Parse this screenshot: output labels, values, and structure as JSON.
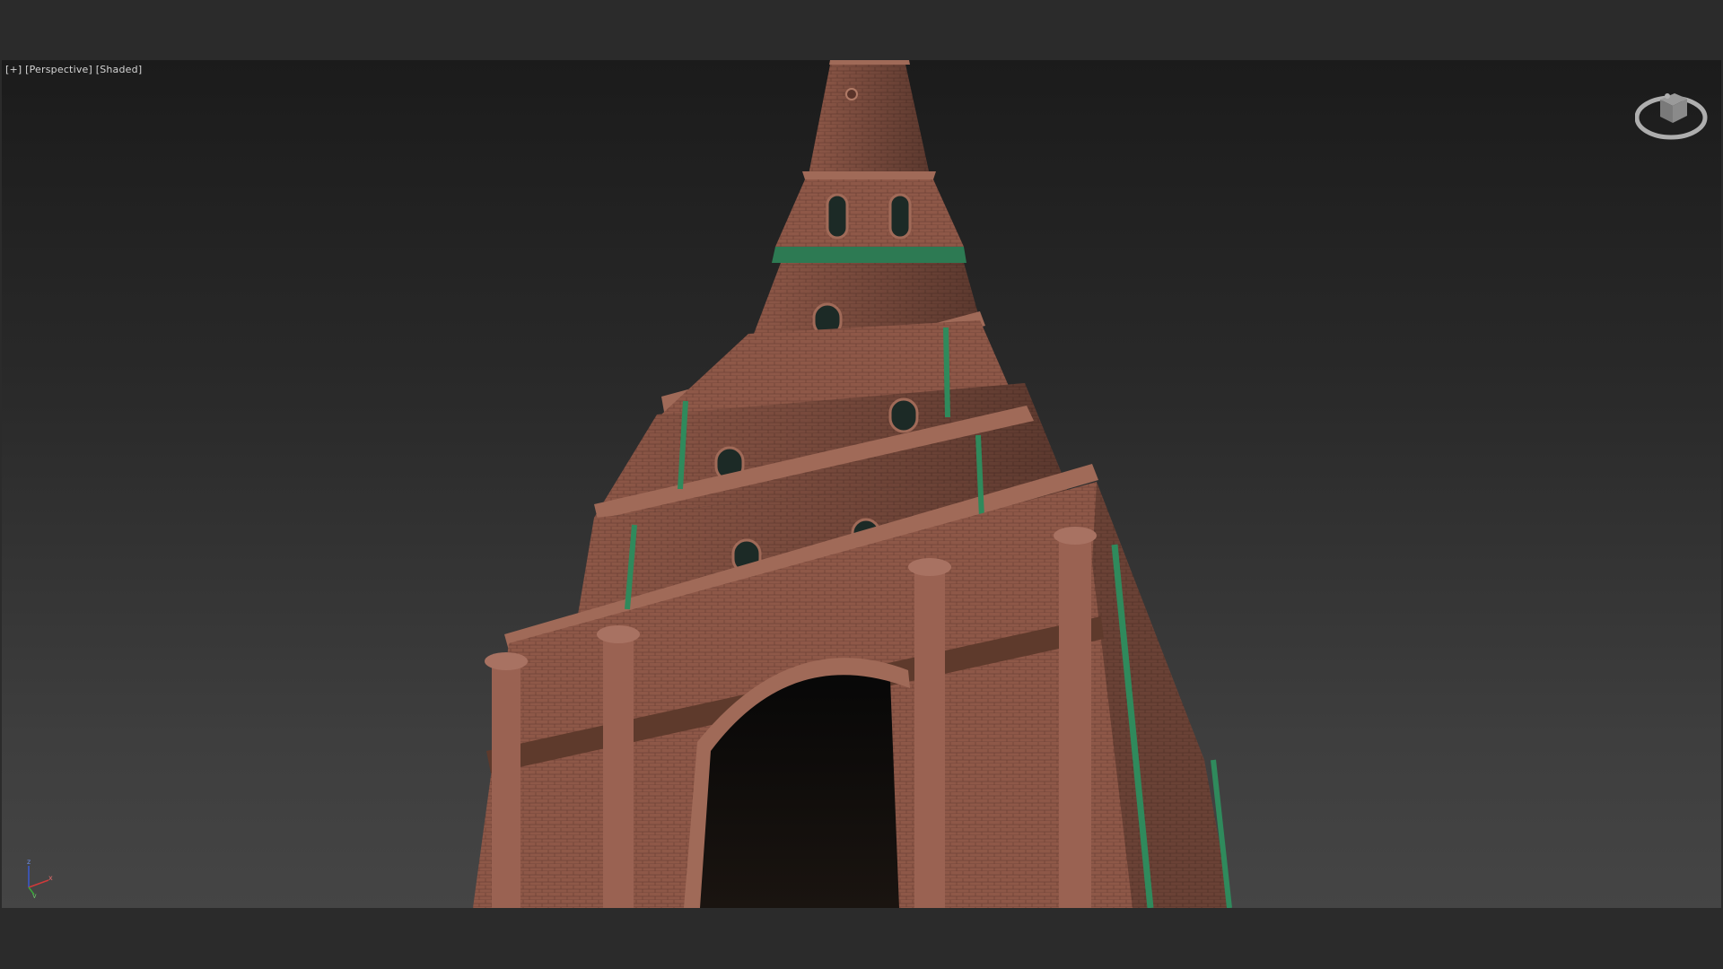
{
  "viewport": {
    "label_plus": "[+]",
    "label_view": "[Perspective]",
    "label_shading": "[Shaded]"
  },
  "viewcube": {
    "icon": "viewcube-icon"
  },
  "axis": {
    "x": "x",
    "y": "y",
    "z": "z",
    "colors": {
      "x": "#d03a3a",
      "y": "#3aa83a",
      "z": "#3a5ad0"
    }
  },
  "colors": {
    "brick": "#8e5848",
    "brick_dark": "#6b3f33",
    "trim": "#a06a58",
    "copper_green": "#2f8a5c"
  }
}
